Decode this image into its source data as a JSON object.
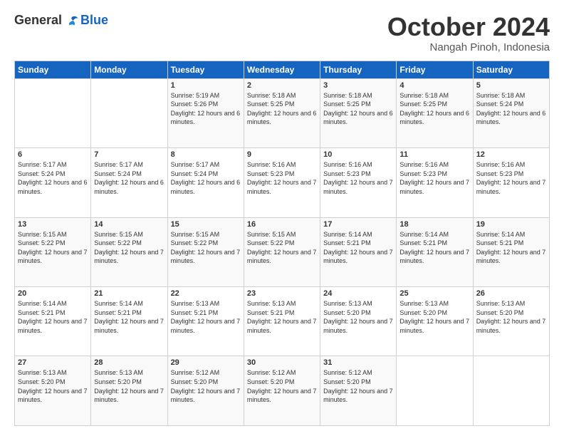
{
  "logo": {
    "general": "General",
    "blue": "Blue"
  },
  "header": {
    "month": "October 2024",
    "location": "Nangah Pinoh, Indonesia"
  },
  "weekdays": [
    "Sunday",
    "Monday",
    "Tuesday",
    "Wednesday",
    "Thursday",
    "Friday",
    "Saturday"
  ],
  "weeks": [
    [
      {
        "day": "",
        "sunrise": "",
        "sunset": "",
        "daylight": ""
      },
      {
        "day": "",
        "sunrise": "",
        "sunset": "",
        "daylight": ""
      },
      {
        "day": "1",
        "sunrise": "Sunrise: 5:19 AM",
        "sunset": "Sunset: 5:26 PM",
        "daylight": "Daylight: 12 hours and 6 minutes."
      },
      {
        "day": "2",
        "sunrise": "Sunrise: 5:18 AM",
        "sunset": "Sunset: 5:25 PM",
        "daylight": "Daylight: 12 hours and 6 minutes."
      },
      {
        "day": "3",
        "sunrise": "Sunrise: 5:18 AM",
        "sunset": "Sunset: 5:25 PM",
        "daylight": "Daylight: 12 hours and 6 minutes."
      },
      {
        "day": "4",
        "sunrise": "Sunrise: 5:18 AM",
        "sunset": "Sunset: 5:25 PM",
        "daylight": "Daylight: 12 hours and 6 minutes."
      },
      {
        "day": "5",
        "sunrise": "Sunrise: 5:18 AM",
        "sunset": "Sunset: 5:24 PM",
        "daylight": "Daylight: 12 hours and 6 minutes."
      }
    ],
    [
      {
        "day": "6",
        "sunrise": "Sunrise: 5:17 AM",
        "sunset": "Sunset: 5:24 PM",
        "daylight": "Daylight: 12 hours and 6 minutes."
      },
      {
        "day": "7",
        "sunrise": "Sunrise: 5:17 AM",
        "sunset": "Sunset: 5:24 PM",
        "daylight": "Daylight: 12 hours and 6 minutes."
      },
      {
        "day": "8",
        "sunrise": "Sunrise: 5:17 AM",
        "sunset": "Sunset: 5:24 PM",
        "daylight": "Daylight: 12 hours and 6 minutes."
      },
      {
        "day": "9",
        "sunrise": "Sunrise: 5:16 AM",
        "sunset": "Sunset: 5:23 PM",
        "daylight": "Daylight: 12 hours and 7 minutes."
      },
      {
        "day": "10",
        "sunrise": "Sunrise: 5:16 AM",
        "sunset": "Sunset: 5:23 PM",
        "daylight": "Daylight: 12 hours and 7 minutes."
      },
      {
        "day": "11",
        "sunrise": "Sunrise: 5:16 AM",
        "sunset": "Sunset: 5:23 PM",
        "daylight": "Daylight: 12 hours and 7 minutes."
      },
      {
        "day": "12",
        "sunrise": "Sunrise: 5:16 AM",
        "sunset": "Sunset: 5:23 PM",
        "daylight": "Daylight: 12 hours and 7 minutes."
      }
    ],
    [
      {
        "day": "13",
        "sunrise": "Sunrise: 5:15 AM",
        "sunset": "Sunset: 5:22 PM",
        "daylight": "Daylight: 12 hours and 7 minutes."
      },
      {
        "day": "14",
        "sunrise": "Sunrise: 5:15 AM",
        "sunset": "Sunset: 5:22 PM",
        "daylight": "Daylight: 12 hours and 7 minutes."
      },
      {
        "day": "15",
        "sunrise": "Sunrise: 5:15 AM",
        "sunset": "Sunset: 5:22 PM",
        "daylight": "Daylight: 12 hours and 7 minutes."
      },
      {
        "day": "16",
        "sunrise": "Sunrise: 5:15 AM",
        "sunset": "Sunset: 5:22 PM",
        "daylight": "Daylight: 12 hours and 7 minutes."
      },
      {
        "day": "17",
        "sunrise": "Sunrise: 5:14 AM",
        "sunset": "Sunset: 5:21 PM",
        "daylight": "Daylight: 12 hours and 7 minutes."
      },
      {
        "day": "18",
        "sunrise": "Sunrise: 5:14 AM",
        "sunset": "Sunset: 5:21 PM",
        "daylight": "Daylight: 12 hours and 7 minutes."
      },
      {
        "day": "19",
        "sunrise": "Sunrise: 5:14 AM",
        "sunset": "Sunset: 5:21 PM",
        "daylight": "Daylight: 12 hours and 7 minutes."
      }
    ],
    [
      {
        "day": "20",
        "sunrise": "Sunrise: 5:14 AM",
        "sunset": "Sunset: 5:21 PM",
        "daylight": "Daylight: 12 hours and 7 minutes."
      },
      {
        "day": "21",
        "sunrise": "Sunrise: 5:14 AM",
        "sunset": "Sunset: 5:21 PM",
        "daylight": "Daylight: 12 hours and 7 minutes."
      },
      {
        "day": "22",
        "sunrise": "Sunrise: 5:13 AM",
        "sunset": "Sunset: 5:21 PM",
        "daylight": "Daylight: 12 hours and 7 minutes."
      },
      {
        "day": "23",
        "sunrise": "Sunrise: 5:13 AM",
        "sunset": "Sunset: 5:21 PM",
        "daylight": "Daylight: 12 hours and 7 minutes."
      },
      {
        "day": "24",
        "sunrise": "Sunrise: 5:13 AM",
        "sunset": "Sunset: 5:20 PM",
        "daylight": "Daylight: 12 hours and 7 minutes."
      },
      {
        "day": "25",
        "sunrise": "Sunrise: 5:13 AM",
        "sunset": "Sunset: 5:20 PM",
        "daylight": "Daylight: 12 hours and 7 minutes."
      },
      {
        "day": "26",
        "sunrise": "Sunrise: 5:13 AM",
        "sunset": "Sunset: 5:20 PM",
        "daylight": "Daylight: 12 hours and 7 minutes."
      }
    ],
    [
      {
        "day": "27",
        "sunrise": "Sunrise: 5:13 AM",
        "sunset": "Sunset: 5:20 PM",
        "daylight": "Daylight: 12 hours and 7 minutes."
      },
      {
        "day": "28",
        "sunrise": "Sunrise: 5:13 AM",
        "sunset": "Sunset: 5:20 PM",
        "daylight": "Daylight: 12 hours and 7 minutes."
      },
      {
        "day": "29",
        "sunrise": "Sunrise: 5:12 AM",
        "sunset": "Sunset: 5:20 PM",
        "daylight": "Daylight: 12 hours and 7 minutes."
      },
      {
        "day": "30",
        "sunrise": "Sunrise: 5:12 AM",
        "sunset": "Sunset: 5:20 PM",
        "daylight": "Daylight: 12 hours and 7 minutes."
      },
      {
        "day": "31",
        "sunrise": "Sunrise: 5:12 AM",
        "sunset": "Sunset: 5:20 PM",
        "daylight": "Daylight: 12 hours and 7 minutes."
      },
      {
        "day": "",
        "sunrise": "",
        "sunset": "",
        "daylight": ""
      },
      {
        "day": "",
        "sunrise": "",
        "sunset": "",
        "daylight": ""
      }
    ]
  ]
}
